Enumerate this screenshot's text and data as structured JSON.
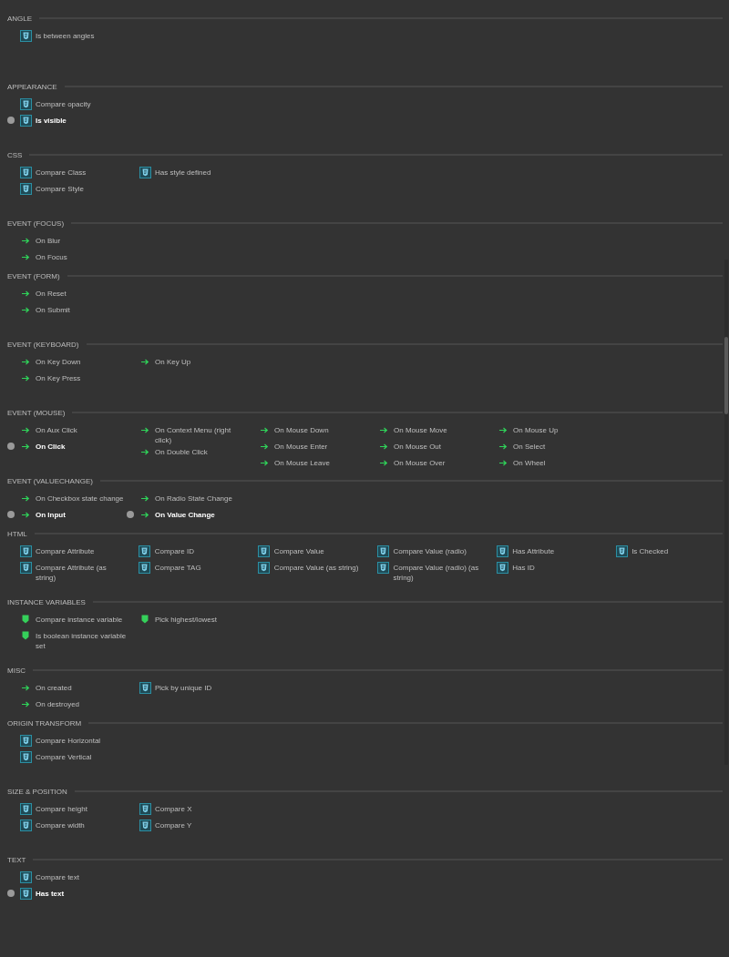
{
  "sections": [
    {
      "title": "ANGLE",
      "columns": [
        [
          {
            "kind": "html",
            "label": "Is between angles",
            "active": false
          }
        ]
      ]
    },
    {
      "title": "APPEARANCE",
      "columns": [
        [
          {
            "kind": "html",
            "label": "Compare opacity",
            "active": false
          },
          {
            "kind": "html",
            "label": "Is visible",
            "active": true
          }
        ]
      ]
    },
    {
      "title": "CSS",
      "columns": [
        [
          {
            "kind": "html",
            "label": "Compare Class",
            "active": false
          },
          {
            "kind": "html",
            "label": "Compare Style",
            "active": false
          }
        ],
        [
          {
            "kind": "html",
            "label": "Has style defined",
            "active": false
          }
        ]
      ]
    },
    {
      "title": "EVENT (FOCUS)",
      "columns": [
        [
          {
            "kind": "event",
            "label": "On Blur",
            "active": false
          },
          {
            "kind": "event",
            "label": "On Focus",
            "active": false
          }
        ]
      ]
    },
    {
      "title": "EVENT (FORM)",
      "columns": [
        [
          {
            "kind": "event",
            "label": "On Reset",
            "active": false
          },
          {
            "kind": "event",
            "label": "On Submit",
            "active": false
          }
        ]
      ]
    },
    {
      "title": "EVENT (KEYBOARD)",
      "columns": [
        [
          {
            "kind": "event",
            "label": "On Key Down",
            "active": false
          },
          {
            "kind": "event",
            "label": "On Key Press",
            "active": false
          }
        ],
        [
          {
            "kind": "event",
            "label": "On Key Up",
            "active": false
          }
        ]
      ]
    },
    {
      "title": "EVENT (MOUSE)",
      "columns": [
        [
          {
            "kind": "event",
            "label": "On Aux Click",
            "active": false
          },
          {
            "kind": "event",
            "label": "On Click",
            "active": true
          }
        ],
        [
          {
            "kind": "event",
            "label": "On Context Menu (right click)",
            "active": false
          },
          {
            "kind": "event",
            "label": "On Double Click",
            "active": false
          }
        ],
        [
          {
            "kind": "event",
            "label": "On Mouse Down",
            "active": false
          },
          {
            "kind": "event",
            "label": "On Mouse Enter",
            "active": false
          },
          {
            "kind": "event",
            "label": "On Mouse Leave",
            "active": false
          }
        ],
        [
          {
            "kind": "event",
            "label": "On Mouse Move",
            "active": false
          },
          {
            "kind": "event",
            "label": "On Mouse Out",
            "active": false
          },
          {
            "kind": "event",
            "label": "On Mouse Over",
            "active": false
          }
        ],
        [
          {
            "kind": "event",
            "label": "On Mouse Up",
            "active": false
          },
          {
            "kind": "event",
            "label": "On Select",
            "active": false
          },
          {
            "kind": "event",
            "label": "On Wheel",
            "active": false
          }
        ]
      ]
    },
    {
      "title": "EVENT (VALUECHANGE)",
      "columns": [
        [
          {
            "kind": "event",
            "label": "On Checkbox state change",
            "active": false
          },
          {
            "kind": "event",
            "label": "On Input",
            "active": true
          }
        ],
        [
          {
            "kind": "event",
            "label": "On Radio State Change",
            "active": false
          },
          {
            "kind": "event",
            "label": "On Value Change",
            "active": true
          }
        ]
      ]
    },
    {
      "title": "HTML",
      "columns": [
        [
          {
            "kind": "html",
            "label": "Compare Attribute",
            "active": false
          },
          {
            "kind": "html",
            "label": "Compare Attribute (as string)",
            "active": false
          }
        ],
        [
          {
            "kind": "html",
            "label": "Compare ID",
            "active": false
          },
          {
            "kind": "html",
            "label": "Compare TAG",
            "active": false
          }
        ],
        [
          {
            "kind": "html",
            "label": "Compare Value",
            "active": false
          },
          {
            "kind": "html",
            "label": "Compare Value (as string)",
            "active": false
          }
        ],
        [
          {
            "kind": "html",
            "label": "Compare Value (radio)",
            "active": false
          },
          {
            "kind": "html",
            "label": "Compare Value (radio) (as string)",
            "active": false
          }
        ],
        [
          {
            "kind": "html",
            "label": "Has Attribute",
            "active": false
          },
          {
            "kind": "html",
            "label": "Has ID",
            "active": false
          }
        ],
        [
          {
            "kind": "html",
            "label": "Is Checked",
            "active": false
          }
        ]
      ]
    },
    {
      "title": "INSTANCE VARIABLES",
      "columns": [
        [
          {
            "kind": "variable",
            "label": "Compare instance variable",
            "active": false
          },
          {
            "kind": "variable",
            "label": "Is boolean instance variable set",
            "active": false
          }
        ],
        [
          {
            "kind": "variable",
            "label": "Pick highest/lowest",
            "active": false
          }
        ]
      ]
    },
    {
      "title": "MISC",
      "columns": [
        [
          {
            "kind": "event",
            "label": "On created",
            "active": false
          },
          {
            "kind": "event",
            "label": "On destroyed",
            "active": false
          }
        ],
        [
          {
            "kind": "html",
            "label": "Pick by unique ID",
            "active": false
          }
        ]
      ]
    },
    {
      "title": "ORIGIN TRANSFORM",
      "columns": [
        [
          {
            "kind": "html",
            "label": "Compare Horizontal",
            "active": false
          },
          {
            "kind": "html",
            "label": "Compare Vertical",
            "active": false
          }
        ]
      ]
    },
    {
      "title": "SIZE & POSITION",
      "columns": [
        [
          {
            "kind": "html",
            "label": "Compare height",
            "active": false
          },
          {
            "kind": "html",
            "label": "Compare width",
            "active": false
          }
        ],
        [
          {
            "kind": "html",
            "label": "Compare X",
            "active": false
          },
          {
            "kind": "html",
            "label": "Compare Y",
            "active": false
          }
        ]
      ]
    },
    {
      "title": "TEXT",
      "columns": [
        [
          {
            "kind": "html",
            "label": "Compare text",
            "active": false
          },
          {
            "kind": "html",
            "label": "Has text",
            "active": true
          }
        ]
      ]
    }
  ]
}
